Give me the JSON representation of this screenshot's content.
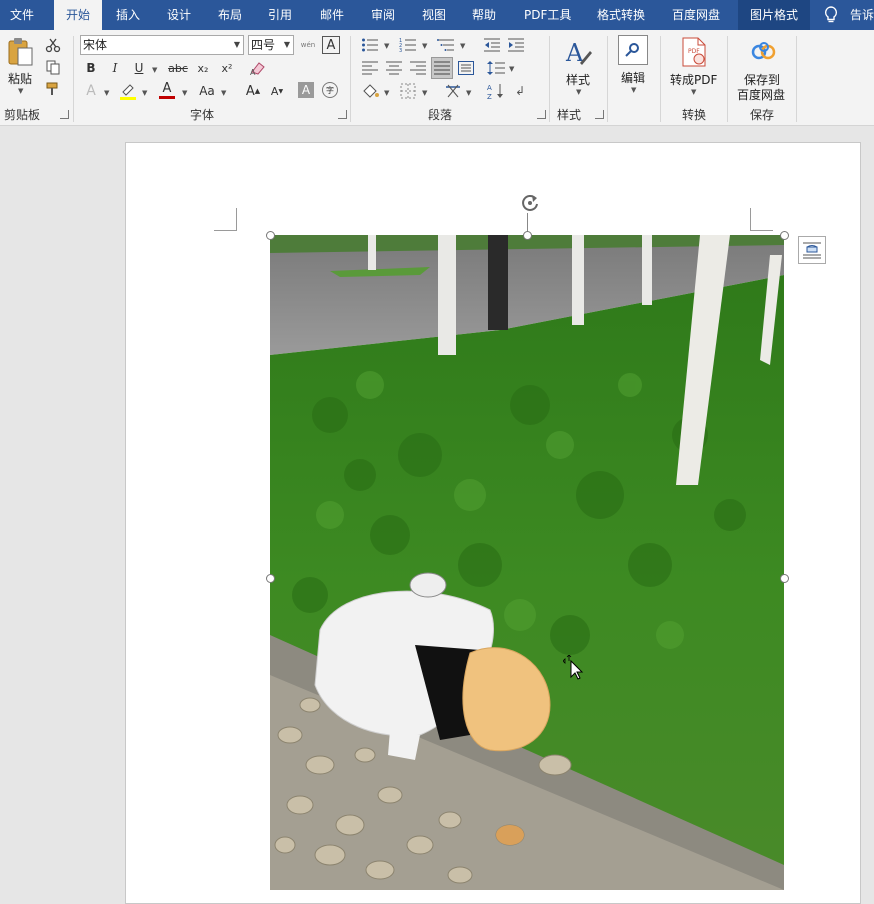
{
  "tabs": {
    "file": "文件",
    "home": "开始",
    "insert": "插入",
    "design": "设计",
    "layout": "布局",
    "references": "引用",
    "mailings": "邮件",
    "review": "审阅",
    "view": "视图",
    "help": "帮助",
    "pdf_tools": "PDF工具",
    "format_convert": "格式转换",
    "baidu_pan": "百度网盘",
    "picture_format": "图片格式",
    "tell_me": "告诉"
  },
  "clipboard": {
    "paste": "粘贴",
    "group": "剪贴板"
  },
  "font": {
    "name": "宋体",
    "size": "四号",
    "group": "字体",
    "bold": "B",
    "italic": "I",
    "underline": "U",
    "strike": "abc",
    "subscript": "x₂",
    "superscript": "x²",
    "change_case": "Aa",
    "grow": "A",
    "shrink": "A",
    "clear": "A",
    "phonetic": "wén",
    "enclose": "字",
    "font_color": "A"
  },
  "paragraph": {
    "group": "段落"
  },
  "styles": {
    "label": "样式",
    "group": "样式"
  },
  "editing": {
    "label": "编辑"
  },
  "convert": {
    "label": "转成PDF",
    "group": "转换"
  },
  "save": {
    "label_line1": "保存到",
    "label_line2": "百度网盘",
    "group": "保存"
  },
  "colors": {
    "accent": "#2b579a",
    "font_color_bar": "#c00000",
    "highlight_bar": "#ffff00"
  }
}
